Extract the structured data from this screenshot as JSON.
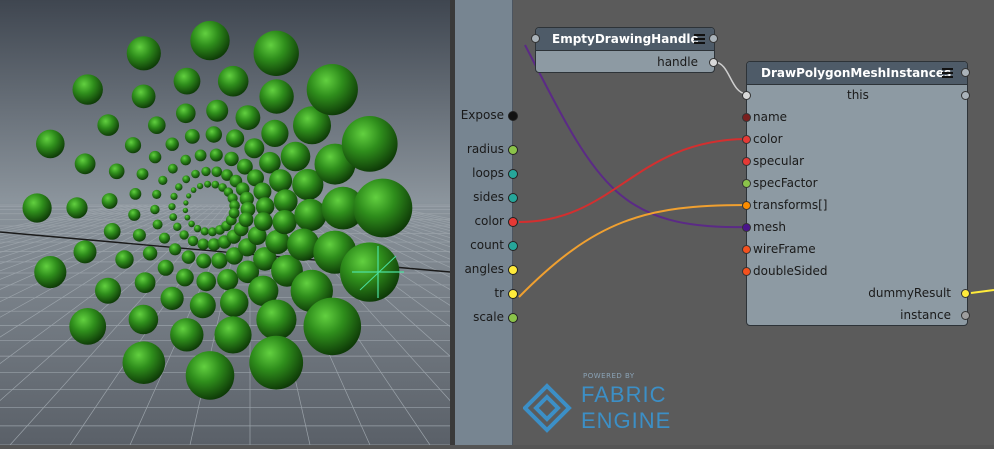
{
  "viewport": {
    "sphere_color": "#2e8a1c",
    "grid_color": "#9aa2a9"
  },
  "graph": {
    "exposed_ports": [
      {
        "label": "Expose",
        "color": "#111111"
      },
      {
        "label": "radius",
        "color": "#8bc34a"
      },
      {
        "label": "loops",
        "color": "#26a69a"
      },
      {
        "label": "sides",
        "color": "#26a69a"
      },
      {
        "label": "color",
        "color": "#e53935"
      },
      {
        "label": "count",
        "color": "#26a69a"
      },
      {
        "label": "angles",
        "color": "#ffeb3b"
      },
      {
        "label": "tr",
        "color": "#ffeb3b"
      },
      {
        "label": "scale",
        "color": "#8bc34a"
      }
    ],
    "handle_node": {
      "title": "EmptyDrawingHandle",
      "output_label": "handle"
    },
    "mesh_node": {
      "title": "DrawPolygonMeshInstances",
      "this_label": "this",
      "inputs": [
        {
          "label": "name",
          "color": "#7a1f1f"
        },
        {
          "label": "color",
          "color": "#e53935"
        },
        {
          "label": "specular",
          "color": "#e53935"
        },
        {
          "label": "specFactor",
          "color": "#8bc34a"
        },
        {
          "label": "transforms[]",
          "color": "#fb8c00"
        },
        {
          "label": "mesh",
          "color": "#4a148c"
        },
        {
          "label": "wireFrame",
          "color": "#f4511e"
        },
        {
          "label": "doubleSided",
          "color": "#f4511e"
        }
      ],
      "outputs": [
        {
          "label": "dummyResult",
          "color": "#ffeb3b"
        },
        {
          "label": "instance",
          "color": "#9e9e9e"
        }
      ]
    },
    "wire_colors": {
      "color": "#d32f2f",
      "tr": "#f0a030",
      "mesh": "#5b2a86",
      "handle": "#cccccc",
      "result": "#ffeb3b"
    },
    "logo": {
      "powered_by": "POWERED BY",
      "line1": "FABRIC",
      "line2": "ENGINE",
      "color": "#3c8fc6"
    }
  }
}
